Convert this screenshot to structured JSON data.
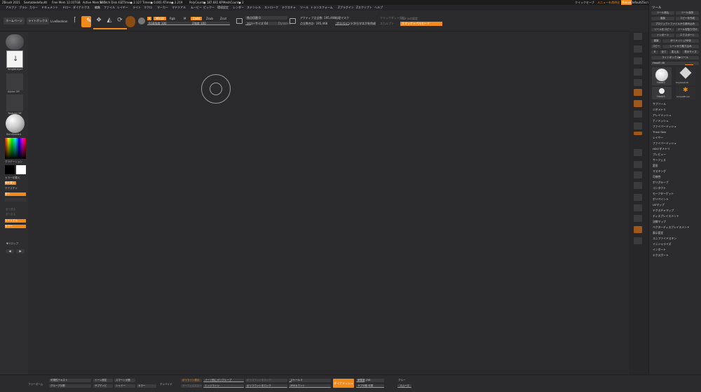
{
  "titlebar": {
    "app": "ZBrush 2021",
    "items": [
      "Sextabledefaultt",
      "Free Mem 12.01TGB",
      "Active Mem 697",
      "Scratch Disk 43",
      "ZTime● 2.127 Timer● 0.001 ATime● 2.219",
      "PolyCount● 187.681 KP",
      "MeshCount● 2"
    ],
    "right_items": [
      "クイックセーブ",
      "メニューを透明化",
      "Menus",
      "DefaultZScript"
    ]
  },
  "menubar": [
    "アルファ",
    "ブラシ",
    "カラー",
    "ドキュメント",
    "ドロー",
    "ダイナミクス",
    "編集",
    "ファイル",
    "レイヤー",
    "ライト",
    "マクロ",
    "マーカー",
    "マテリアル",
    "ムービー",
    "ピックー",
    "環境設定",
    "レンダー",
    "ステンシル",
    "ストローク",
    "テクスチャ",
    "ツール",
    "トランスフォーム",
    "Zプラグイン",
    "Zスクリプト",
    "ヘルプ"
  ],
  "toolbar": {
    "home": "ホームページ",
    "lightbox": "ライトボックス",
    "live_boolean": "LiveBoolean",
    "edit": "編集",
    "draw": "描画",
    "move": "移動",
    "scale": "スケール",
    "rotate": "回転",
    "a": "A",
    "mrgb": "MRGB",
    "rgb": "Rgb",
    "m": "M",
    "rgb_intensity": "RGB強度 100",
    "zadd": "Zadd",
    "zsub": "Zsub",
    "zcut": "Zcut",
    "z_intensity": "Z強度 100",
    "focal_shift": "焦点切替 0",
    "draw_size": "ドローサイズ 64",
    "dynamic": "Dynamic",
    "active_points": "アクティブ点全数: 195,468",
    "total_points": "点全数合計: 195,468",
    "shrink": "処理マスク",
    "polypaint": "ポリペイントからマスクを作成",
    "local_symmetry": "カメラの設定",
    "sculpt": "スカルプト",
    "subdivide": "スマッチャパルモード",
    "extra1": "クリックダット設定",
    "extra2": "スマッチャパルモード"
  },
  "lefttray": {
    "brush": "SingleLayer",
    "stroke": "Alpha Off",
    "alpha": "Texture Off",
    "material": "SkinShade4",
    "gradient": "グラデーション",
    "switch_color": "カラー切替え",
    "alternate": "値を替え",
    "fill_label": "テクスチャ",
    "fill_btn": "塗り",
    "disabled1": "全て塗る",
    "disabled2": "塗り吉る",
    "on1": "マテリアル",
    "on2": "カラー",
    "flip": "▼ドロップ",
    "arrows": [
      "◀",
      "▶"
    ]
  },
  "toolpanel": {
    "header": "ツール",
    "buttons": [
      [
        "ツール読込",
        "ツール保存"
      ],
      [
        "複製",
        "コピーを作成"
      ],
      [
        "プロジェクトファイルから読み込み",
        ""
      ],
      [
        "ツールをコピー",
        "ツールを貼り付け"
      ],
      [
        "インポート",
        "エクスポート"
      ],
      [
        "複製",
        "ポリメッシュ3D化"
      ],
      [
        "コピー",
        "シーンから取り込み"
      ],
      [
        "全て",
        "ライトボックスツール"
      ]
    ],
    "r_label": "R",
    "set_label": "変える",
    "view_label": "表示サイズ",
    "light_label": "ライトボックス▶ツール",
    "count": "Head3 48",
    "thumb_labels": [
      "Head3",
      "PolyMesh3D",
      "Head3",
      "SimpleBrush"
    ],
    "subpalettes": [
      "サブツール",
      "ジオメトリ",
      "アレイメッシュ",
      "ナノメッシュ",
      "ファイバーメッシュ",
      "Thick Skin",
      "レイヤー",
      "ファイバーメッシュ",
      "HDジオメトリ",
      "プレビュー",
      "サーフェス",
      "変形",
      "マスキング",
      "可視性",
      "ポリグループ",
      "コンタクト",
      "モーフターゲット",
      "ポリペイント",
      "UVマップ",
      "テクスチャマップ",
      "ディスプレイスメント",
      "法線マップ",
      "ベクターディスプレイスメント",
      "表示設定",
      "ユニファイドスキン",
      "イニシャライズ",
      "インポート",
      "エクスポート"
    ]
  },
  "bottombar": {
    "b1": "フリーズーム",
    "b2": "可視性テキスト",
    "b3": "グループ分割",
    "b4": "トーン設定",
    "b5": "サブディビ",
    "b6": "スマート分割",
    "b7": "カラー",
    "b8": "シャドー",
    "b9": "ディバイド",
    "b10": "ポリライン表示",
    "b11": "サーフェススムーズ",
    "b12": "パーツ別にポリグループ",
    "b13": "エッジライン",
    "b14": "ポリコウントをロック",
    "b15": "スケール 5",
    "b16": "ZREカウント",
    "dynamesh": "ダイナメッシュ",
    "b17": "解像度 256",
    "b18": "サブ分割 可視",
    "b19": "グルー",
    "b20": "スムーズ"
  }
}
